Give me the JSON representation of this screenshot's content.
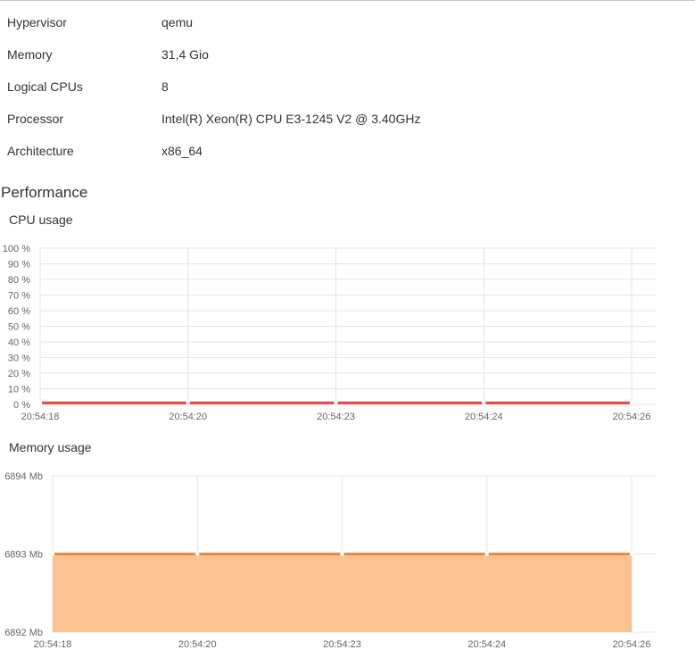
{
  "info": [
    {
      "label": "Hypervisor",
      "value": "qemu"
    },
    {
      "label": "Memory",
      "value": "31,4 Gio"
    },
    {
      "label": "Logical CPUs",
      "value": "8"
    },
    {
      "label": "Processor",
      "value": "Intel(R) Xeon(R) CPU E3-1245 V2 @ 3.40GHz"
    },
    {
      "label": "Architecture",
      "value": "x86_64"
    }
  ],
  "performance": {
    "title": "Performance"
  },
  "chart_data": [
    {
      "type": "line",
      "title": "CPU usage",
      "x": [
        "20:54:18",
        "20:54:20",
        "20:54:23",
        "20:54:24",
        "20:54:26"
      ],
      "series": [
        {
          "values": [
            1,
            1,
            1,
            1,
            1
          ],
          "color": "#e8433c"
        }
      ],
      "ylim": [
        0,
        100
      ],
      "yticks": [
        "0 %",
        "10 %",
        "20 %",
        "30 %",
        "40 %",
        "50 %",
        "60 %",
        "70 %",
        "80 %",
        "90 %",
        "100 %"
      ],
      "grid": true
    },
    {
      "type": "area",
      "title": "Memory usage",
      "x": [
        "20:54:18",
        "20:54:20",
        "20:54:23",
        "20:54:24",
        "20:54:26"
      ],
      "series": [
        {
          "values": [
            6893,
            6893,
            6893,
            6893,
            6893
          ],
          "color": "#f0883a",
          "fill": "#fbc392"
        }
      ],
      "ylim": [
        6892,
        6894
      ],
      "yticks": [
        "6892 Mb",
        "6893 Mb",
        "6894 Mb"
      ],
      "grid": true
    }
  ]
}
